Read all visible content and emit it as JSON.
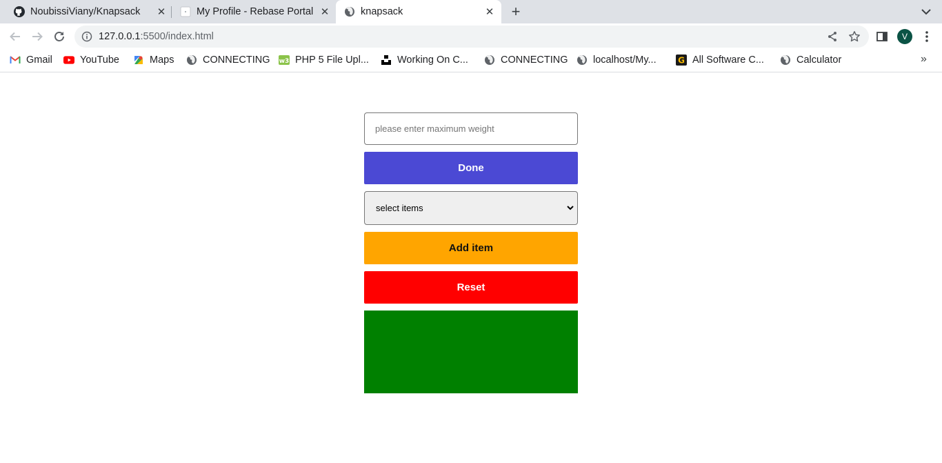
{
  "browser": {
    "tabs": [
      {
        "title": "NoubissiViany/Knapsack",
        "icon": "github-icon"
      },
      {
        "title": "My Profile - Rebase Portal",
        "icon": "page-icon"
      },
      {
        "title": "knapsack",
        "icon": "globe-icon",
        "active": true
      }
    ],
    "address": {
      "host": "127.0.0.1",
      "rest": ":5500/index.html"
    },
    "profile_initial": "V",
    "bookmarks": [
      {
        "label": "Gmail",
        "icon": "gmail-icon"
      },
      {
        "label": "YouTube",
        "icon": "youtube-icon"
      },
      {
        "label": "Maps",
        "icon": "maps-icon"
      },
      {
        "label": "CONNECTING",
        "icon": "globe-icon"
      },
      {
        "label": "PHP 5 File Upl...",
        "icon": "w3-icon"
      },
      {
        "label": "Working On C...",
        "icon": "unsplash-icon"
      },
      {
        "label": "CONNECTING",
        "icon": "globe-icon"
      },
      {
        "label": "localhost/My...",
        "icon": "globe-icon"
      },
      {
        "label": "All Software C...",
        "icon": "g-icon"
      },
      {
        "label": "Calculator",
        "icon": "globe-icon"
      }
    ],
    "bookmarks_overflow": "»"
  },
  "app": {
    "weight_input": {
      "placeholder": "please enter maximum weight",
      "value": ""
    },
    "done_label": "Done",
    "items_select": {
      "selected": "select items"
    },
    "add_label": "Add item",
    "reset_label": "Reset",
    "colors": {
      "done": "#4b49d4",
      "add": "#ffa500",
      "reset": "#ff0000",
      "result": "#008000"
    }
  }
}
